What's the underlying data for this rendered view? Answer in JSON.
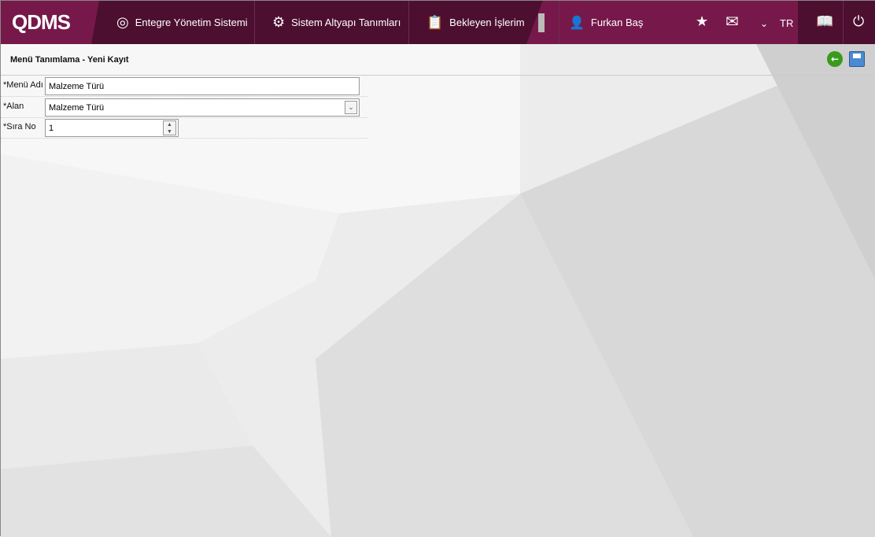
{
  "brand": "QDMS",
  "nav": [
    {
      "label": "Entegre Yönetim Sistemi"
    },
    {
      "label": "Sistem Altyapı Tanımları"
    },
    {
      "label": "Bekleyen İşlerim"
    }
  ],
  "user": "Furkan Baş",
  "language": "TR",
  "page_title": "Menü Tanımlama - Yeni Kayıt",
  "form": {
    "menu_adi_label": "*Menü Adı",
    "menu_adi_value": "Malzeme Türü",
    "alan_label": "*Alan",
    "alan_value": "Malzeme Türü",
    "sira_label": "*Sıra No",
    "sira_value": "1"
  }
}
